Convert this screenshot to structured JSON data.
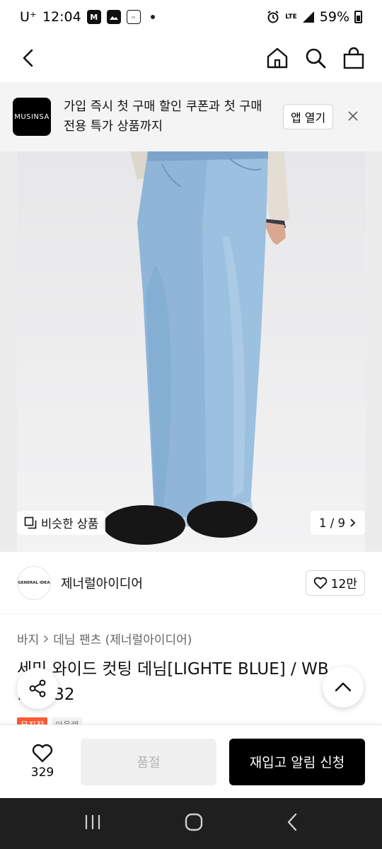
{
  "status_bar": {
    "carrier": "U⁺",
    "time": "12:04",
    "network": "LTE",
    "battery": "59%"
  },
  "app_banner": {
    "logo_text": "MUSINSA",
    "message": "가입 즉시 첫 구매 할인 쿠폰과 첫 구매 전용 특가 상품까지",
    "open_label": "앱 열기"
  },
  "image_overlay": {
    "similar_label": "비슷한 상품",
    "pager": "1 / 9"
  },
  "brand": {
    "logo_text": "GENERAL IDEA",
    "name": "제너럴아이디어",
    "likes": "12만"
  },
  "breadcrumb": {
    "category": "바지",
    "subcategory": "데님 팬츠 (제너럴아이디어)"
  },
  "product": {
    "title": "세미 와이드 컷팅 데님[LIGHTE BLUE] / WB… …1532",
    "badges": [
      "무진장",
      "아울렛"
    ]
  },
  "action_bar": {
    "wish_count": "329",
    "soldout_label": "품절",
    "restock_label": "재입고 알림 신청"
  },
  "colors": {
    "accent_orange": "#ff5a36",
    "banner_bg": "#f4f4f4",
    "denim": "#8db3d6"
  }
}
